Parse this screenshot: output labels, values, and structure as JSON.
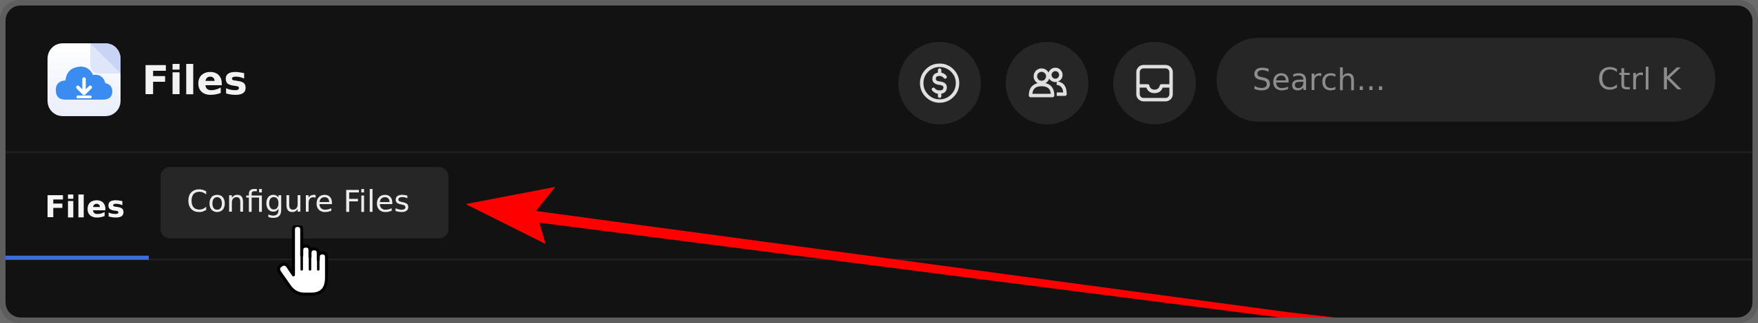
{
  "app": {
    "title": "Files",
    "icon": "cloud-download-icon"
  },
  "header_actions": [
    {
      "name": "billing-button",
      "icon": "dollar-circle-icon"
    },
    {
      "name": "team-button",
      "icon": "users-icon"
    },
    {
      "name": "inbox-button",
      "icon": "inbox-tray-icon"
    }
  ],
  "search": {
    "placeholder": "Search...",
    "value": "",
    "shortcut": "Ctrl K"
  },
  "tabs": [
    {
      "label": "Files",
      "active": true
    },
    {
      "label": "Configure Files",
      "active": false,
      "hovered": true
    }
  ],
  "colors": {
    "background": "#121212",
    "surface": "#262626",
    "active_tab_underline": "#3f6ad8",
    "annotation_arrow": "#ff0000",
    "app_icon_cloud": "#3b8cf0"
  },
  "annotation": {
    "type": "arrow",
    "target": "Configure Files"
  },
  "cursor": "pointer-hand"
}
